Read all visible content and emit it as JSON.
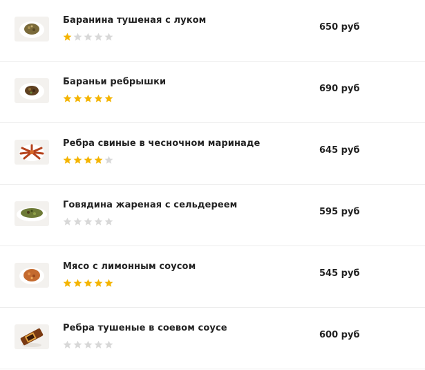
{
  "colors": {
    "star_filled": "#f4b400",
    "star_empty": "#d8d8d8",
    "divider": "#ececec"
  },
  "items": [
    {
      "name": "Баранина тушеная с луком",
      "price": "650 руб",
      "rating": 1,
      "max_rating": 5,
      "thumb_icon": "dish-lamb-onion-icon"
    },
    {
      "name": "Бараньи ребрышки",
      "price": "690 руб",
      "rating": 5,
      "max_rating": 5,
      "thumb_icon": "dish-lamb-ribs-icon"
    },
    {
      "name": "Ребра свиные в чесночном маринаде",
      "price": "645 руб",
      "rating": 4,
      "max_rating": 5,
      "thumb_icon": "dish-pork-ribs-icon"
    },
    {
      "name": "Говядина жареная с сельдереем",
      "price": "595 руб",
      "rating": 0,
      "max_rating": 5,
      "thumb_icon": "dish-beef-celery-icon"
    },
    {
      "name": "Мясо с лимонным соусом",
      "price": "545 руб",
      "rating": 5,
      "max_rating": 5,
      "thumb_icon": "dish-lemon-meat-icon"
    },
    {
      "name": "Ребра тушеные в соевом соусе",
      "price": "600 руб",
      "rating": 0,
      "max_rating": 5,
      "thumb_icon": "dish-soy-ribs-icon"
    }
  ]
}
